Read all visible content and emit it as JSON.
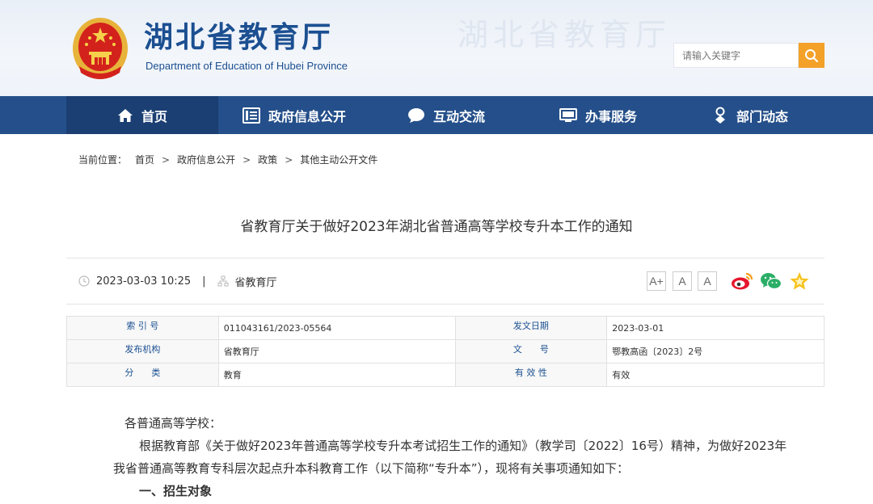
{
  "header": {
    "title": "湖北省教育厅",
    "subtitle": "Department of Education of Hubei Province",
    "search_placeholder": "请输入关键字"
  },
  "nav": {
    "items": [
      {
        "label": "首页",
        "icon": "home-icon"
      },
      {
        "label": "政府信息公开",
        "icon": "document-list-icon"
      },
      {
        "label": "互动交流",
        "icon": "chat-bubble-icon"
      },
      {
        "label": "办事服务",
        "icon": "monitor-icon"
      },
      {
        "label": "部门动态",
        "icon": "person-location-icon"
      }
    ]
  },
  "breadcrumb": {
    "prefix": "当前位置：",
    "items": [
      "首页",
      "政府信息公开",
      "政策",
      "其他主动公开文件"
    ],
    "separator": ">"
  },
  "article": {
    "title": "省教育厅关于做好2023年湖北省普通高等学校专升本工作的通知",
    "datetime": "2023-03-03 10:25",
    "meta_separator": "|",
    "source": "省教育厅",
    "font_buttons": [
      "A+",
      "A",
      "A"
    ]
  },
  "info_table": {
    "rows": [
      [
        {
          "label": "索 引 号",
          "value": "011043161/2023-05564"
        },
        {
          "label": "发文日期",
          "value": "2023-03-01"
        }
      ],
      [
        {
          "label": "发布机构",
          "value": "省教育厅"
        },
        {
          "label": "文　　号",
          "value": "鄂教高函〔2023〕2号"
        }
      ],
      [
        {
          "label": "分　　类",
          "value": "教育"
        },
        {
          "label": "有 效 性",
          "value": "有效"
        }
      ]
    ]
  },
  "body": {
    "salutation": "各普通高等学校：",
    "paragraph1": "根据教育部《关于做好2023年普通高等学校专升本考试招生工作的通知》（教学司〔2022〕16号）精神，为做好2023年我省普通高等教育专科层次起点升本科教育工作（以下简称“专升本”），现将有关事项通知如下：",
    "section1": "一、招生对象"
  },
  "colors": {
    "nav_bg": "#244f8a",
    "nav_active": "#1b3f72",
    "brand_blue": "#1b4f91",
    "search_button": "#f3a128"
  }
}
